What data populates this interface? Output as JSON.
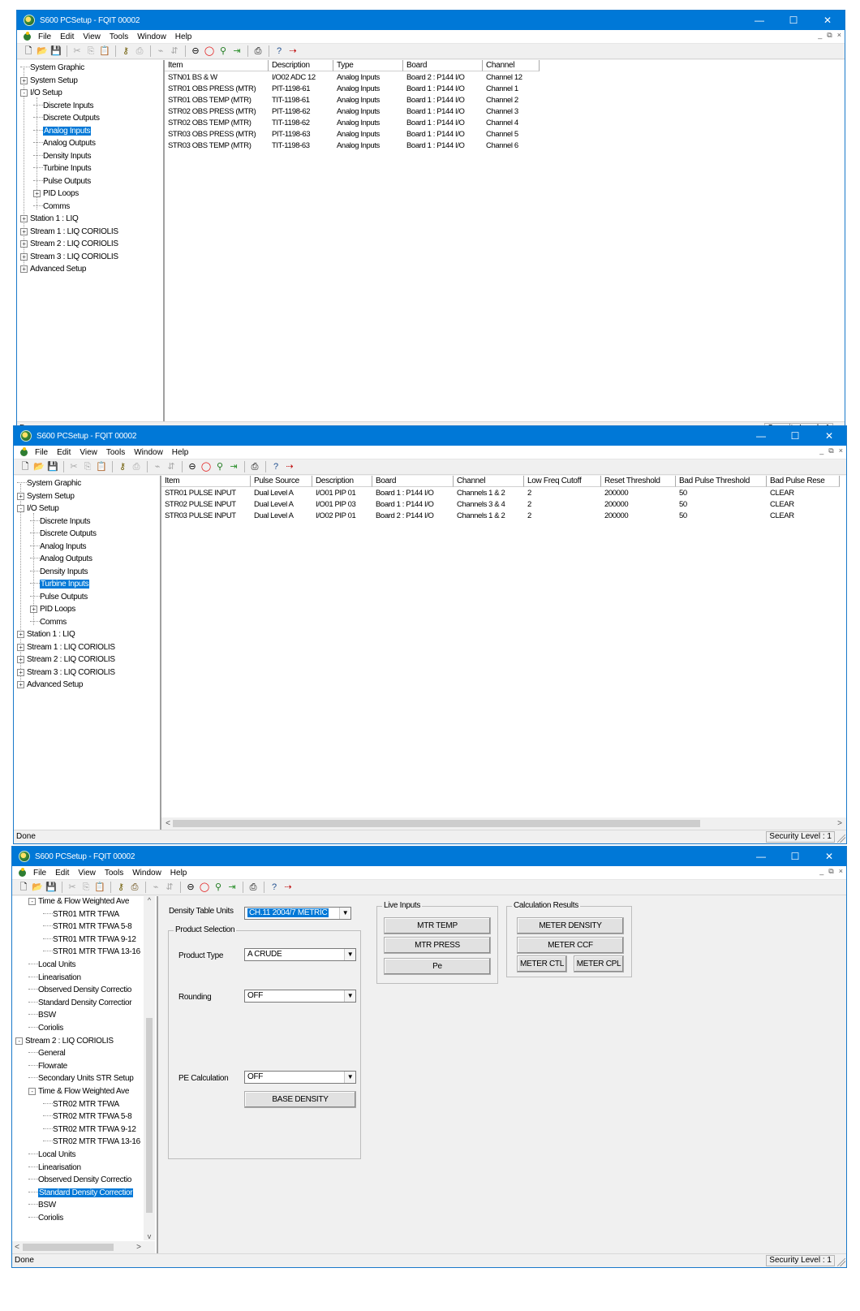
{
  "app_title": "S600 PCSetup  -  FQIT 00002",
  "title_buttons": {
    "minimize": "—",
    "maximize": "☐",
    "close": "✕"
  },
  "menu": [
    "File",
    "Edit",
    "View",
    "Tools",
    "Window",
    "Help"
  ],
  "mdi_buttons": {
    "minimize": "_",
    "restore": "⧉",
    "close": "×"
  },
  "status": {
    "left": "Done",
    "security": "Security Level : 1"
  },
  "window1": {
    "tree": [
      {
        "label": "System Graphic"
      },
      {
        "label": "System Setup",
        "expander": "+"
      },
      {
        "label": "I/O Setup",
        "expander": "-"
      },
      {
        "label": "Discrete Inputs"
      },
      {
        "label": "Discrete Outputs"
      },
      {
        "label": "Analog Inputs",
        "selected": true
      },
      {
        "label": "Analog Outputs"
      },
      {
        "label": "Density Inputs"
      },
      {
        "label": "Turbine Inputs"
      },
      {
        "label": "Pulse Outputs"
      },
      {
        "label": "PID Loops",
        "expander": "+"
      },
      {
        "label": "Comms"
      },
      {
        "label": "Station 1 : LIQ",
        "expander": "+"
      },
      {
        "label": "Stream 1 : LIQ CORIOLIS",
        "expander": "+"
      },
      {
        "label": "Stream 2 : LIQ CORIOLIS",
        "expander": "+"
      },
      {
        "label": "Stream 3 : LIQ CORIOLIS",
        "expander": "+"
      },
      {
        "label": "Advanced Setup",
        "expander": "+"
      }
    ],
    "columns": [
      "Item",
      "Description",
      "Type",
      "Board",
      "Channel"
    ],
    "rows": [
      [
        "STN01 BS & W",
        "I/O02 ADC 12",
        "Analog Inputs",
        "Board 2 : P144 I/O",
        "Channel 12"
      ],
      [
        "STR01 OBS PRESS (MTR)",
        "PIT-1198-61",
        "Analog Inputs",
        "Board 1 : P144 I/O",
        "Channel 1"
      ],
      [
        "STR01 OBS TEMP (MTR)",
        "TIT-1198-61",
        "Analog Inputs",
        "Board 1 : P144 I/O",
        "Channel 2"
      ],
      [
        "STR02 OBS PRESS (MTR)",
        "PIT-1198-62",
        "Analog Inputs",
        "Board 1 : P144 I/O",
        "Channel 3"
      ],
      [
        "STR02 OBS TEMP (MTR)",
        "TIT-1198-62",
        "Analog Inputs",
        "Board 1 : P144 I/O",
        "Channel 4"
      ],
      [
        "STR03 OBS PRESS (MTR)",
        "PIT-1198-63",
        "Analog Inputs",
        "Board 1 : P144 I/O",
        "Channel 5"
      ],
      [
        "STR03 OBS TEMP (MTR)",
        "TIT-1198-63",
        "Analog Inputs",
        "Board 1 : P144 I/O",
        "Channel 6"
      ]
    ]
  },
  "window2": {
    "tree": [
      {
        "label": "System Graphic"
      },
      {
        "label": "System Setup",
        "expander": "+"
      },
      {
        "label": "I/O Setup",
        "expander": "-"
      },
      {
        "label": "Discrete Inputs"
      },
      {
        "label": "Discrete Outputs"
      },
      {
        "label": "Analog Inputs"
      },
      {
        "label": "Analog Outputs"
      },
      {
        "label": "Density Inputs"
      },
      {
        "label": "Turbine Inputs",
        "selected": true
      },
      {
        "label": "Pulse Outputs"
      },
      {
        "label": "PID Loops",
        "expander": "+"
      },
      {
        "label": "Comms"
      },
      {
        "label": "Station 1 : LIQ",
        "expander": "+"
      },
      {
        "label": "Stream 1 : LIQ CORIOLIS",
        "expander": "+"
      },
      {
        "label": "Stream 2 : LIQ CORIOLIS",
        "expander": "+"
      },
      {
        "label": "Stream 3 : LIQ CORIOLIS",
        "expander": "+"
      },
      {
        "label": "Advanced Setup",
        "expander": "+"
      }
    ],
    "columns": [
      "Item",
      "Pulse Source",
      "Description",
      "Board",
      "Channel",
      "Low Freq Cutoff",
      "Reset Threshold",
      "Bad Pulse Threshold",
      "Bad Pulse Rese"
    ],
    "rows": [
      [
        "STR01 PULSE INPUT",
        "Dual Level A",
        "I/O01 PIP 01",
        "Board 1 : P144 I/O",
        "Channels 1 & 2",
        "2",
        "200000",
        "50",
        "CLEAR"
      ],
      [
        "STR02 PULSE INPUT",
        "Dual Level A",
        "I/O01 PIP 03",
        "Board 1 : P144 I/O",
        "Channels 3 & 4",
        "2",
        "200000",
        "50",
        "CLEAR"
      ],
      [
        "STR03 PULSE INPUT",
        "Dual Level A",
        "I/O02 PIP 01",
        "Board 2 : P144 I/O",
        "Channels 1 & 2",
        "2",
        "200000",
        "50",
        "CLEAR"
      ]
    ],
    "scroll_left": "<",
    "scroll_right": ">"
  },
  "window3": {
    "tree": [
      {
        "label": "Time & Flow Weighted Ave",
        "expander": "-",
        "level": 1
      },
      {
        "label": "STR01 MTR TFWA",
        "level": 2
      },
      {
        "label": "STR01 MTR TFWA 5-8",
        "level": 2
      },
      {
        "label": "STR01 MTR TFWA 9-12",
        "level": 2
      },
      {
        "label": "STR01 MTR TFWA 13-16",
        "level": 2
      },
      {
        "label": "Local Units",
        "level": 1
      },
      {
        "label": "Linearisation",
        "level": 1
      },
      {
        "label": "Observed Density Correctio",
        "level": 1
      },
      {
        "label": "Standard Density Correctior",
        "level": 1
      },
      {
        "label": "BSW",
        "level": 1
      },
      {
        "label": "Coriolis",
        "level": 1
      },
      {
        "label": "Stream 2 : LIQ CORIOLIS",
        "expander": "-",
        "level": 0
      },
      {
        "label": "General",
        "level": 1
      },
      {
        "label": "Flowrate",
        "level": 1
      },
      {
        "label": "Secondary Units STR Setup",
        "level": 1
      },
      {
        "label": "Time & Flow Weighted Ave",
        "expander": "-",
        "level": 1
      },
      {
        "label": "STR02 MTR TFWA",
        "level": 2
      },
      {
        "label": "STR02 MTR TFWA 5-8",
        "level": 2
      },
      {
        "label": "STR02 MTR TFWA 9-12",
        "level": 2
      },
      {
        "label": "STR02 MTR TFWA 13-16",
        "level": 2
      },
      {
        "label": "Local Units",
        "level": 1
      },
      {
        "label": "Linearisation",
        "level": 1
      },
      {
        "label": "Observed Density Correctio",
        "level": 1
      },
      {
        "label": "Standard Density Correctior",
        "level": 1,
        "selected": true
      },
      {
        "label": "BSW",
        "level": 1
      },
      {
        "label": "Coriolis",
        "level": 1
      }
    ],
    "density_table_units_label": "Density Table Units",
    "density_table_units_value": "CH.11 2004/7 METRIC",
    "product_selection": {
      "title": "Product Selection",
      "product_type_label": "Product Type",
      "product_type_value": "A CRUDE",
      "rounding_label": "Rounding",
      "rounding_value": "OFF",
      "pe_calc_label": "PE Calculation",
      "pe_calc_value": "OFF",
      "base_density_button": "BASE DENSITY"
    },
    "live_inputs": {
      "title": "Live Inputs",
      "buttons": [
        "MTR TEMP",
        "MTR PRESS",
        "Pe"
      ]
    },
    "calc_results": {
      "title": "Calculation Results",
      "meter_density": "METER DENSITY",
      "meter_ccf": "METER CCF",
      "meter_ctl": "METER CTL",
      "meter_cpl": "METER CPL"
    },
    "scroll_up": "^",
    "scroll_down": "v",
    "scroll_left": "<",
    "scroll_right": ">"
  }
}
